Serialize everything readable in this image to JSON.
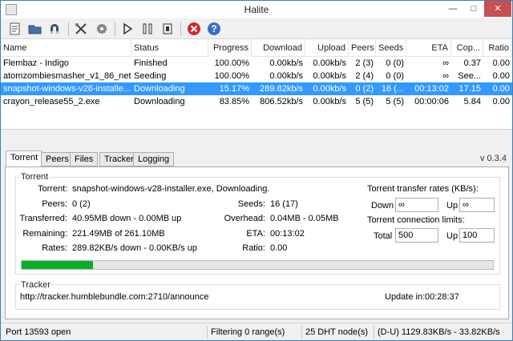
{
  "window": {
    "title": "Halite"
  },
  "toolbar": {
    "buttons": [
      {
        "name": "open-torrent-icon"
      },
      {
        "name": "open-folder-icon"
      },
      {
        "name": "magnet-icon"
      },
      {
        "name": "settings-icon"
      },
      {
        "name": "gear-icon"
      },
      {
        "name": "play-icon"
      },
      {
        "name": "pause-icon"
      },
      {
        "name": "stop-icon"
      },
      {
        "name": "remove-icon"
      },
      {
        "name": "help-icon"
      }
    ]
  },
  "list": {
    "columns": [
      "Name",
      "Status",
      "Progress",
      "Download",
      "Upload",
      "Peers",
      "Seeds",
      "ETA",
      "Cop...",
      "Ratio"
    ],
    "rows": [
      [
        "Flembaz - Indigo",
        "Finished",
        "100.00%",
        "0.00kb/s",
        "0.00kb/s",
        "2 (3)",
        "0 (0)",
        "∞",
        "0.37",
        "0.00"
      ],
      [
        "atomzombiesmasher_v1_86_net...",
        "Seeding",
        "100.00%",
        "0.00kb/s",
        "0.00kb/s",
        "2 (4)",
        "0 (0)",
        "∞",
        "See...",
        "0.00"
      ],
      [
        "snapshot-windows-v28-installe...",
        "Downloading",
        "15.17%",
        "289.82kb/s",
        "0.00kb/s",
        "0 (2)",
        "16 (...",
        "00:13:02",
        "17.15",
        "0.00"
      ],
      [
        "crayon_release55_2.exe",
        "Downloading",
        "83.85%",
        "806.52kb/s",
        "0.00kb/s",
        "5 (5)",
        "5 (5)",
        "00:00:06",
        "5.84",
        "0.00"
      ]
    ],
    "selected_row": 2
  },
  "tabs": [
    "Torrent",
    "Peers",
    "Files",
    "Tracker",
    "Logging"
  ],
  "version": "v 0.3.4",
  "torrent": {
    "group_label": "Torrent",
    "torrent_label": "Torrent:",
    "torrent_value": "snapshot-windows-v28-installer.exe, Downloading.",
    "peers_label": "Peers:",
    "peers_value": "0 (2)",
    "seeds_label": "Seeds:",
    "seeds_value": "16 (17)",
    "transferred_label": "Transferred:",
    "transferred_value": "40.95MB down - 0.00MB up",
    "overhead_label": "Overhead:",
    "overhead_value": "0.04MB - 0.05MB",
    "remaining_label": "Remaining:",
    "remaining_value": "221.49MB of 261.10MB",
    "eta_label": "ETA:",
    "eta_value": "00:13:02",
    "rates_label": "Rates:",
    "rates_value": "289.82KB/s down - 0.00KB/s up",
    "ratio_label": "Ratio:",
    "ratio_value": "0.00",
    "progress_fraction": 0.1517
  },
  "rates": {
    "transfer_title": "Torrent transfer rates (KB/s):",
    "down_label": "Down",
    "down_value": "∞",
    "up_label": "Up",
    "up_value": "∞",
    "conn_title": "Torrent connection limits:",
    "total_label": "Total",
    "total_value": "500",
    "conn_up_label": "Up",
    "conn_up_value": "100"
  },
  "tracker": {
    "group_label": "Tracker",
    "url": "http://tracker.humblebundle.com:2710/announce",
    "update_label": "Update in:",
    "update_value": "00:28:37"
  },
  "status": {
    "port": "Port 13593 open",
    "filtering": "Filtering 0 range(s)",
    "dht": "25 DHT node(s)",
    "rates": "(D-U) 1129.83KB/s - 33.82KB/s"
  },
  "colors": {
    "accent": "#3399ff",
    "progress": "#06b025",
    "close": "#c75050"
  }
}
